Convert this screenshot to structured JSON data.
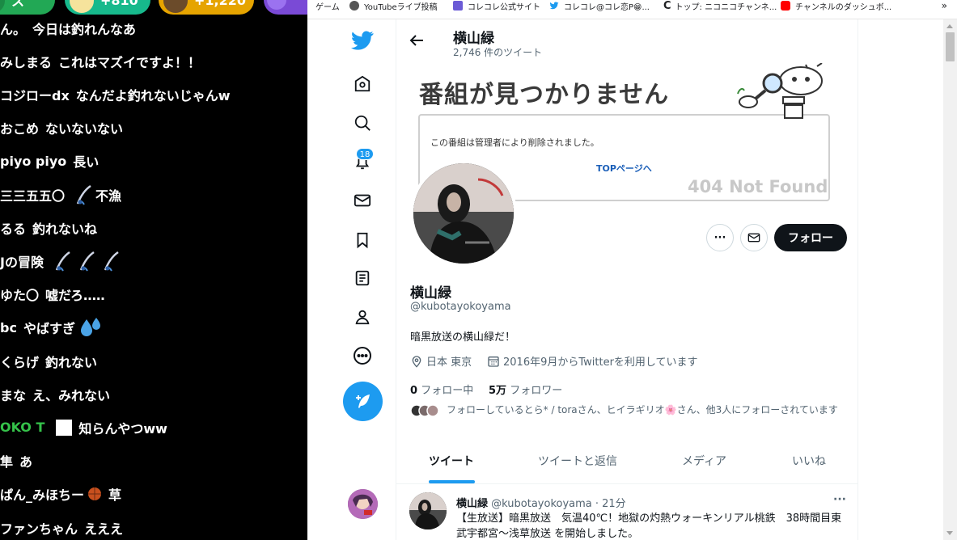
{
  "chat": {
    "gifts": [
      {
        "amount": "ス",
        "color": "#22a855"
      },
      {
        "amount": "+810",
        "color": "#17b98c"
      },
      {
        "amount": "+1,220",
        "color": "#e6a400"
      },
      {
        "amount": "",
        "color": "#7a4ad6"
      }
    ],
    "lines": [
      {
        "user": "ん。",
        "text": "今日は釣れんなあ",
        "user_color": "#ffffff"
      },
      {
        "user": "みしまる",
        "text": "これはマズイですよ！！",
        "user_color": "#ffffff"
      },
      {
        "user": "コジローdx",
        "text": "なんだよ釣れないじゃんw",
        "user_color": "#ffffff"
      },
      {
        "user": "おこめ",
        "text": "ないないない",
        "user_color": "#ffffff"
      },
      {
        "user": "piyo piyo",
        "text": "長い",
        "user_color": "#ffffff"
      },
      {
        "user": "三三五五〇",
        "text": "不漁",
        "user_color": "#ffffff",
        "icons": 1
      },
      {
        "user": "るる",
        "text": "釣れないね",
        "user_color": "#ffffff"
      },
      {
        "user": "Jの冒険",
        "text": "",
        "user_color": "#ffffff",
        "icons": 3
      },
      {
        "user": "ゆた〇",
        "text": "嘘だろ…‥",
        "user_color": "#ffffff"
      },
      {
        "user": "bc",
        "text": "やばすぎ",
        "user_color": "#ffffff",
        "drop": true
      },
      {
        "user": "くらげ",
        "text": "釣れない",
        "user_color": "#ffffff"
      },
      {
        "user": "まな",
        "text": "え、みれない",
        "user_color": "#ffffff"
      },
      {
        "user": "OKO T",
        "text": "知らんやつww",
        "user_color": "#35c24a",
        "chip": true
      },
      {
        "user": "隼",
        "text": "あ",
        "user_color": "#ffffff"
      },
      {
        "user": "ぱん_みほちー",
        "text": "草",
        "user_color": "#ffffff",
        "ball": true
      },
      {
        "user": "ファンちゃん",
        "text": "えええ",
        "user_color": "#ffffff"
      }
    ]
  },
  "bookmarks": [
    {
      "label": "ゲーム",
      "icon_color": ""
    },
    {
      "label": "YouTubeライブ投稿",
      "icon_color": "#555555"
    },
    {
      "label": "コレコレ公式サイト",
      "icon_color": "#6b5bd6"
    },
    {
      "label": "コレコレ@コレ恋P😁...",
      "icon_color": "#1d9bf0"
    },
    {
      "label": "トップ: ニコニコチャンネ...",
      "icon_color": "#222222"
    },
    {
      "label": "チャンネルのダッシュボ...",
      "icon_color": "#ff0000"
    }
  ],
  "bookmarks_more": "»",
  "twitter": {
    "badge_count": "18",
    "header": {
      "name": "横山緑",
      "tweet_count": "2,746 件のツイート"
    },
    "banner": {
      "title": "番組が見つかりません",
      "message": "この番組は管理者により削除されました。",
      "link": "TOPページへ",
      "code": "404 Not Found"
    },
    "actions": {
      "follow_label": "フォロー",
      "more_label": "···"
    },
    "profile": {
      "name": "横山緑",
      "handle": "@kubotayokoyama",
      "bio": "暗黒放送の横山緑だ！",
      "location": "日本 東京",
      "joined": "2016年9月からTwitterを利用しています",
      "following_count": "0",
      "following_label": "フォロー中",
      "followers_count": "5万",
      "followers_label": "フォロワー",
      "followed_by": "フォローしているとら* / toraさん、ヒイラギリオ🌸さん、他3人にフォローされています"
    },
    "tabs": [
      "ツイート",
      "ツイートと返信",
      "メディア",
      "いいね"
    ],
    "tweet": {
      "name": "横山緑",
      "meta": "@kubotayokoyama · 21分",
      "more": "···",
      "text": "【生放送】暗黒放送　気温40℃！地獄の灼熱ウォーキンリアル桃鉄　38時間目東武宇都宮〜浅草放送 を開始しました。"
    }
  },
  "colors": {
    "twitter_blue": "#1d9bf0",
    "text_dark": "#0f1419",
    "text_gray": "#536471"
  }
}
